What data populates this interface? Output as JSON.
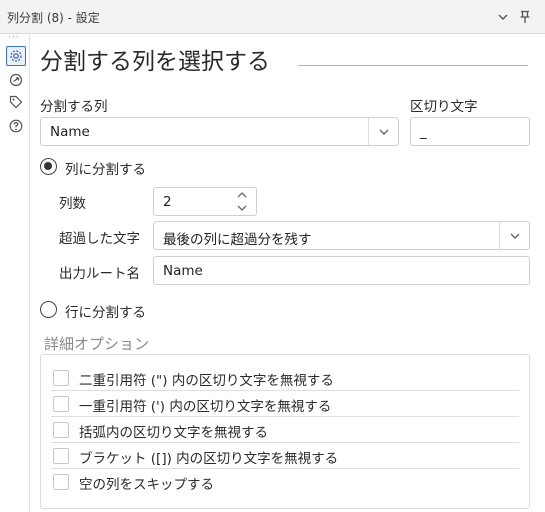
{
  "window": {
    "title": "列分割 (8) - 設定"
  },
  "sidebar": {
    "icons": [
      "gear-icon",
      "connection-icon",
      "tag-icon",
      "help-icon"
    ]
  },
  "main": {
    "heading": "分割する列を選択する",
    "column_label": "分割する列",
    "column_value": "Name",
    "delimiter_label": "区切り文字",
    "delimiter_value": "_",
    "split_to_columns_label": "列に分割する",
    "num_columns_label": "列数",
    "num_columns_value": "2",
    "excess_label": "超過した文字",
    "excess_value": "最後の列に超過分を残す",
    "output_root_label": "出力ルート名",
    "output_root_value": "Name",
    "split_to_rows_label": "行に分割する"
  },
  "options": {
    "title": "詳細オプション",
    "items": [
      {
        "label": "二重引用符 (\") 内の区切り文字を無視する",
        "checked": false
      },
      {
        "label": "一重引用符 (') 内の区切り文字を無視する",
        "checked": false
      },
      {
        "label": "括弧内の区切り文字を無視する",
        "checked": false
      },
      {
        "label": "ブラケット ([]) 内の区切り文字を無視する",
        "checked": false
      },
      {
        "label": "空の列をスキップする",
        "checked": false
      }
    ]
  },
  "colors": {
    "accent": "#3b73c9",
    "dots": "#e06b5b"
  }
}
